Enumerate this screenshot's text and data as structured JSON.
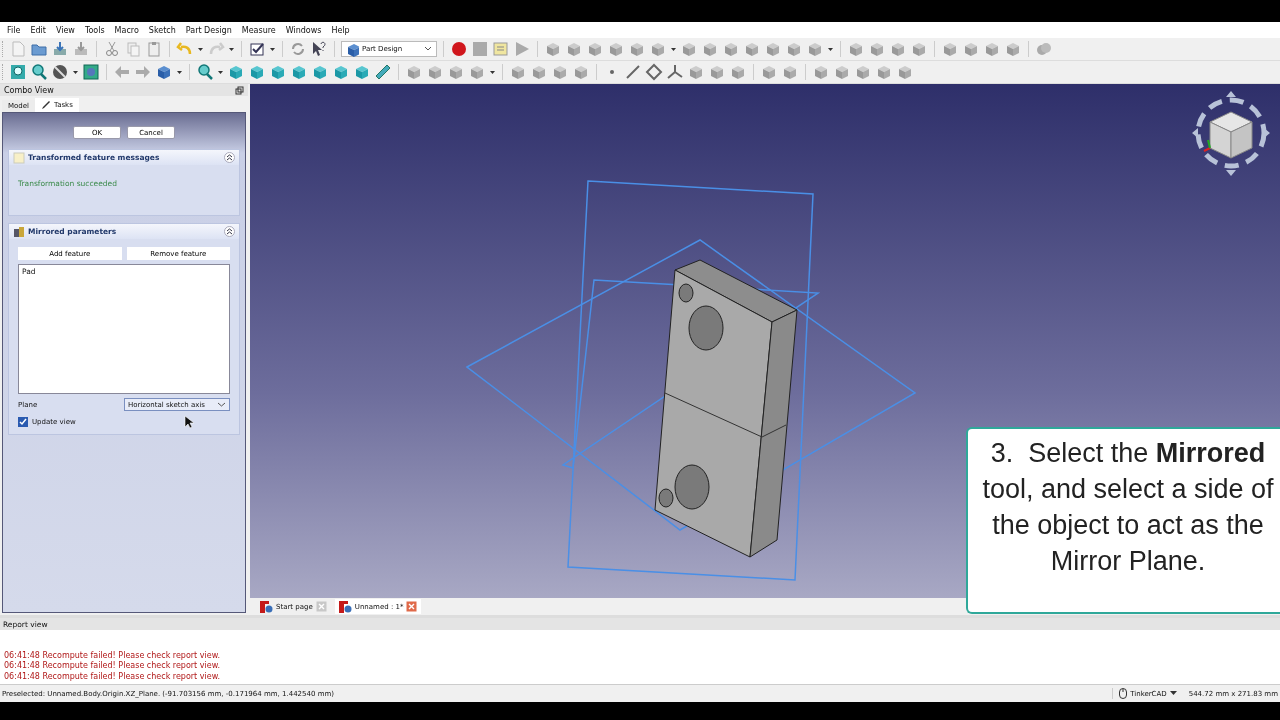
{
  "menu_bar": [
    "File",
    "Edit",
    "View",
    "Tools",
    "Macro",
    "Sketch",
    "Part Design",
    "Measure",
    "Windows",
    "Help"
  ],
  "toolbar": {
    "workbench": "Part Design"
  },
  "combo_view": {
    "title": "Combo View",
    "tabs": [
      {
        "label": "Model",
        "selected": false
      },
      {
        "label": "Tasks",
        "selected": true
      }
    ],
    "buttons": [
      "OK",
      "Cancel"
    ],
    "messages_panel": {
      "title": "Transformed feature messages",
      "message": "Transformation succeeded"
    },
    "mirrored_panel": {
      "title": "Mirrored parameters",
      "buttons": [
        "Add feature",
        "Remove feature"
      ],
      "features": [
        "Pad"
      ],
      "plane_label": "Plane",
      "plane_value": "Horizontal sketch axis",
      "update_view": {
        "label": "Update view",
        "checked": true
      }
    }
  },
  "document_tabs": [
    {
      "label": "Start page",
      "selected": false
    },
    {
      "label": "Unnamed : 1*",
      "selected": true
    }
  ],
  "callout": {
    "text": "3.  Select the **Mirrored** tool, and select a side of the object to act as the Mirror Plane."
  },
  "report_view": {
    "title": "Report view",
    "lines": [
      {
        "time": "06:41:48",
        "message": "Recompute failed! Please check report view."
      },
      {
        "time": "06:41:48",
        "message": "Recompute failed! Please check report view."
      },
      {
        "time": "06:41:48",
        "message": "Recompute failed! Please check report view."
      }
    ]
  },
  "status_bar": {
    "message": "Preselected: Unnamed.Body.Origin.XZ_Plane. (-91.703156 mm, -0.171964 mm, 1.442540 mm)",
    "navigation_style": "TinkerCAD",
    "dimensions": "544.72 mm x 271.83 mm"
  }
}
